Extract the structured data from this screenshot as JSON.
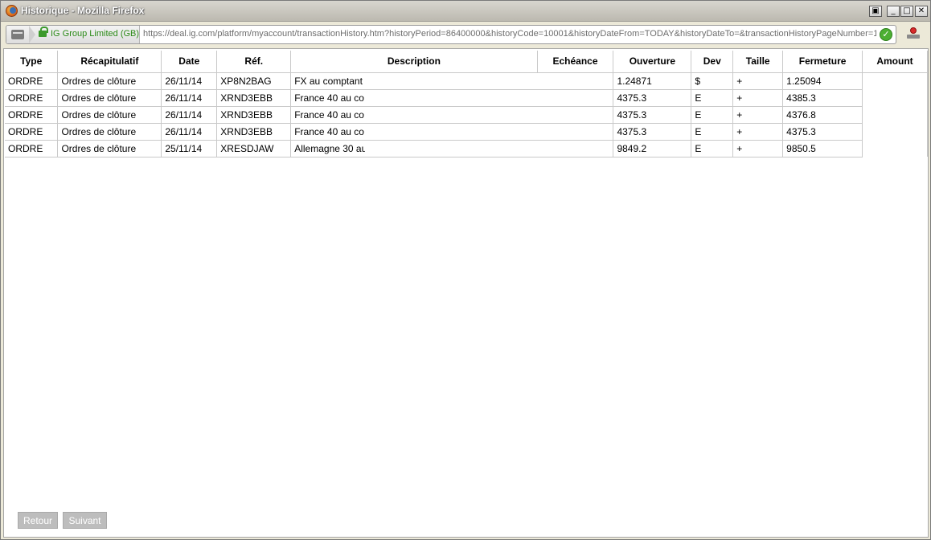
{
  "window": {
    "title": "Historique - Mozilla Firefox"
  },
  "navbar": {
    "identity_label": "IG Group Limited (GB)",
    "url": "https://deal.ig.com/platform/myaccount/transactionHistory.htm?historyPeriod=86400000&historyCode=10001&historyDateFrom=TODAY&historyDateTo=&transactionHistoryPageNumber=1"
  },
  "table": {
    "headers": {
      "type": "Type",
      "recapitulatif": "Récapitulatif",
      "date": "Date",
      "ref": "Réf.",
      "description": "Description",
      "echeance": "Echéance",
      "ouverture": "Ouverture",
      "dev": "Dev",
      "taille": "Taille",
      "fermeture": "Fermeture",
      "amount": "Amount"
    },
    "rows": [
      {
        "type": "ORDRE",
        "recap": "Ordres de clôture",
        "date": "26/11/14",
        "ref": "XP8N2BAG",
        "description": "FX au comptant",
        "echeance": "",
        "ouverture": "1.24871",
        "dev": "$",
        "taille": "+",
        "fermeture": "1.25094"
      },
      {
        "type": "ORDRE",
        "recap": "Ordres de clôture",
        "date": "26/11/14",
        "ref": "XRND3EBB",
        "description": "France 40 au co",
        "echeance": "",
        "ouverture": "4375.3",
        "dev": "E",
        "taille": "+",
        "fermeture": "4385.3"
      },
      {
        "type": "ORDRE",
        "recap": "Ordres de clôture",
        "date": "26/11/14",
        "ref": "XRND3EBB",
        "description": "France 40 au co",
        "echeance": "",
        "ouverture": "4375.3",
        "dev": "E",
        "taille": "+",
        "fermeture": "4376.8"
      },
      {
        "type": "ORDRE",
        "recap": "Ordres de clôture",
        "date": "26/11/14",
        "ref": "XRND3EBB",
        "description": "France 40 au co",
        "echeance": "",
        "ouverture": "4375.3",
        "dev": "E",
        "taille": "+",
        "fermeture": "4375.3"
      },
      {
        "type": "ORDRE",
        "recap": "Ordres de clôture",
        "date": "25/11/14",
        "ref": "XRESDJAW",
        "description": "Allemagne 30 au",
        "echeance": "",
        "ouverture": "9849.2",
        "dev": "E",
        "taille": "+",
        "fermeture": "9850.5"
      }
    ]
  },
  "footer": {
    "back_label": "Retour",
    "next_label": "Suivant"
  }
}
